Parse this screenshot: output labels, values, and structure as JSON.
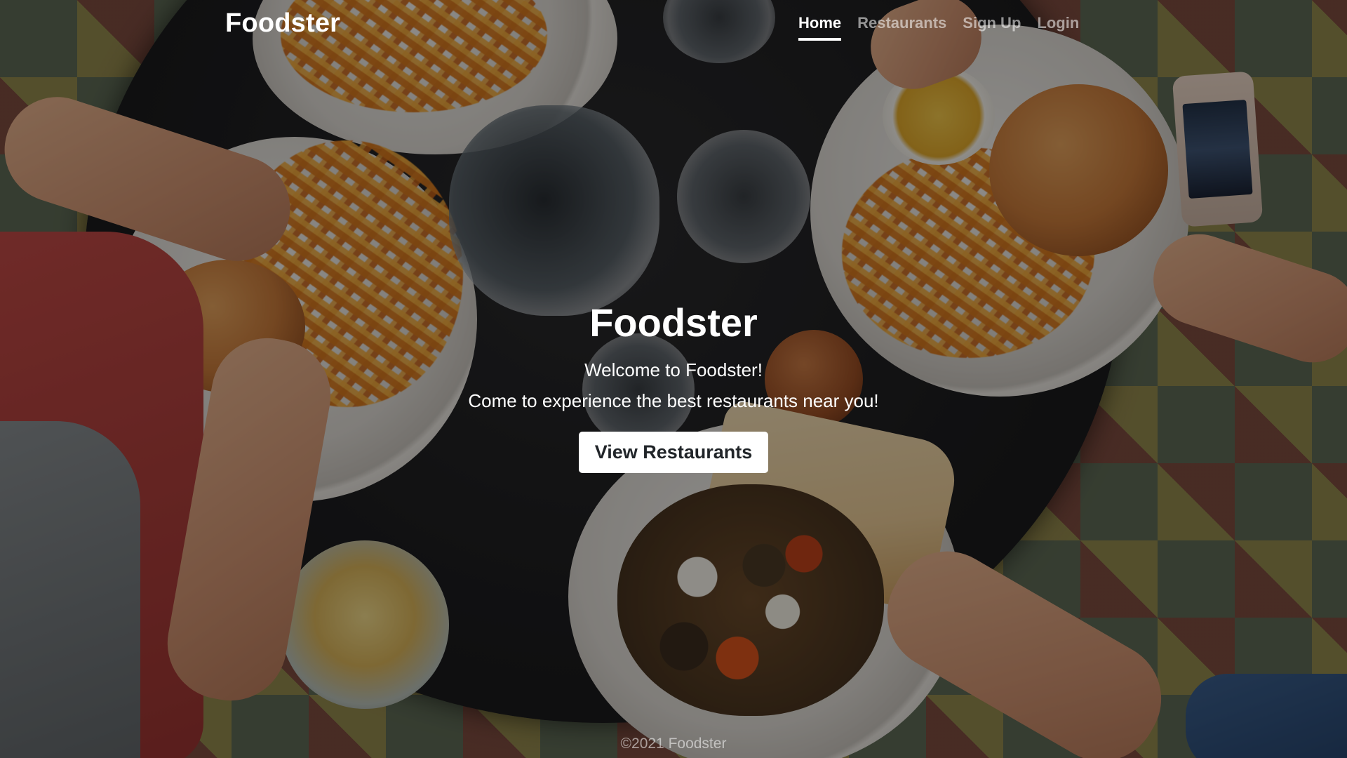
{
  "navbar": {
    "brand": "Foodster",
    "links": [
      {
        "label": "Home",
        "active": true
      },
      {
        "label": "Restaurants",
        "active": false
      },
      {
        "label": "Sign Up",
        "active": false
      },
      {
        "label": "Login",
        "active": false
      }
    ]
  },
  "hero": {
    "title": "Foodster",
    "welcome": "Welcome to Foodster!",
    "tagline": "Come to experience the best restaurants near you!",
    "button_label": "View Restaurants"
  },
  "footer": {
    "text": "©2021 Foodster"
  },
  "colors": {
    "overlay": "#000000",
    "text": "#ffffff",
    "muted_link": "#8c8c8c",
    "button_bg": "#ffffff",
    "button_text": "#212529"
  }
}
